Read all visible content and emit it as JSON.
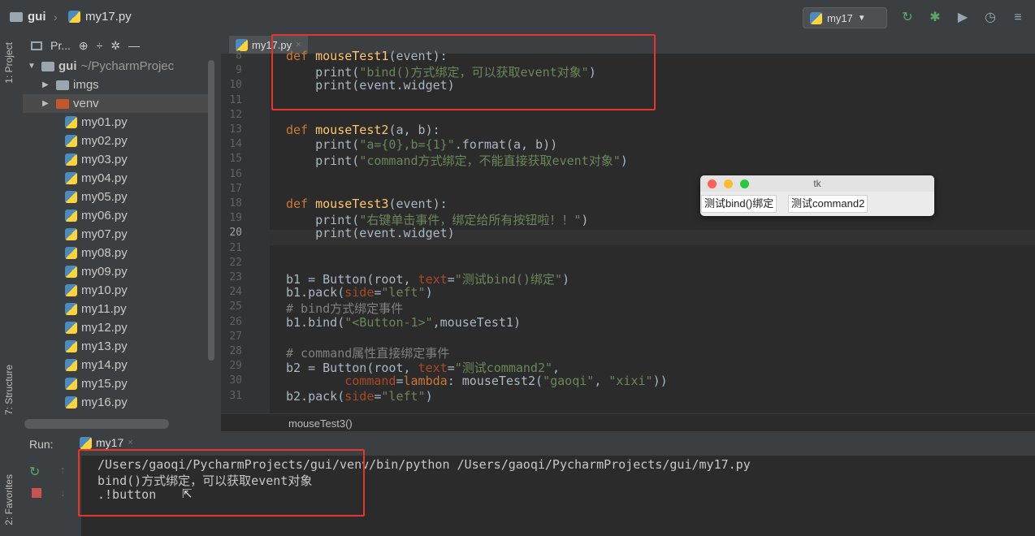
{
  "navbar": {
    "crumb_folder": "gui",
    "crumb_file": "my17.py",
    "run_config": "my17"
  },
  "sidebar": {
    "project_tab": "1: Project",
    "structure_tab": "7: Structure",
    "favorites_tab": "2: Favorites"
  },
  "project": {
    "header_label": "Pr...",
    "root_name": "gui",
    "root_path": "~/PycharmProjec",
    "folders": [
      "imgs",
      "venv"
    ],
    "files": [
      "my01.py",
      "my02.py",
      "my03.py",
      "my04.py",
      "my05.py",
      "my06.py",
      "my07.py",
      "my08.py",
      "my09.py",
      "my10.py",
      "my11.py",
      "my12.py",
      "my13.py",
      "my14.py",
      "my15.py",
      "my16.py"
    ]
  },
  "editor": {
    "tab_label": "my17.py",
    "line_numbers": [
      "8",
      "9",
      "10",
      "11",
      "12",
      "13",
      "14",
      "15",
      "16",
      "17",
      "18",
      "19",
      "20",
      "21",
      "22",
      "23",
      "24",
      "25",
      "26",
      "27",
      "28",
      "29",
      "30",
      "31"
    ],
    "current_line": "20",
    "breadcrumb": "mouseTest3()",
    "code": {
      "l8_def": "def ",
      "l8_name": "mouseTest1",
      "l8_rest": "(event):",
      "l9_a": "    print(",
      "l9_str": "\"bind()方式绑定，可以获取event对象\"",
      "l9_b": ")",
      "l10": "    print(event.widget)",
      "l13_def": "def ",
      "l13_name": "mouseTest2",
      "l13_rest": "(a, b):",
      "l14_a": "    print(",
      "l14_str": "\"a={0},b={1}\"",
      "l14_b": ".format(a, b))",
      "l15_a": "    print(",
      "l15_str": "\"command方式绑定，不能直接获取event对象\"",
      "l15_b": ")",
      "l18_def": "def ",
      "l18_name": "mouseTest3",
      "l18_rest": "(event):",
      "l19_a": "    print(",
      "l19_str": "\"右键单击事件，绑定给所有按钮啦！！\"",
      "l19_b": ")",
      "l20": "    print(event.widget)",
      "l23_a": "b1 = Button(root, ",
      "l23_par": "text",
      "l23_eq": "=",
      "l23_str": "\"测试bind()绑定\"",
      "l23_b": ")",
      "l24_a": "b1.pack(",
      "l24_par": "side",
      "l24_eq": "=",
      "l24_str": "\"left\"",
      "l24_b": ")",
      "l25": "# bind方式绑定事件",
      "l26_a": "b1.bind(",
      "l26_str": "\"<Button-1>\"",
      "l26_b": ",mouseTest1)",
      "l28": "# command属性直接绑定事件",
      "l29_a": "b2 = Button(root, ",
      "l29_par": "text",
      "l29_eq": "=",
      "l29_str": "\"测试command2\"",
      "l29_b": ",",
      "l30_indent": "        ",
      "l30_par": "command",
      "l30_eq": "=",
      "l30_kw": "lambda",
      "l30_a": ": mouseTest2(",
      "l30_s1": "\"gaoqi\"",
      "l30_c": ", ",
      "l30_s2": "\"xixi\"",
      "l30_b": "))",
      "l31_a": "b2.pack(",
      "l31_par": "side",
      "l31_eq": "=",
      "l31_str": "\"left\"",
      "l31_b": ")"
    }
  },
  "tk_window": {
    "title": "tk",
    "button1": "测试bind()绑定",
    "button2": "测试command2"
  },
  "run_panel": {
    "label": "Run:",
    "tab": "my17",
    "output": [
      "/Users/gaoqi/PycharmProjects/gui/venv/bin/python /Users/gaoqi/PycharmProjects/gui/my17.py",
      "bind()方式绑定，可以获取event对象",
      ".!button"
    ]
  },
  "colors": {
    "annotation_box": "#e8352a",
    "keyword": "#cc7832",
    "function_name": "#ffc66d",
    "string": "#6a8759"
  }
}
